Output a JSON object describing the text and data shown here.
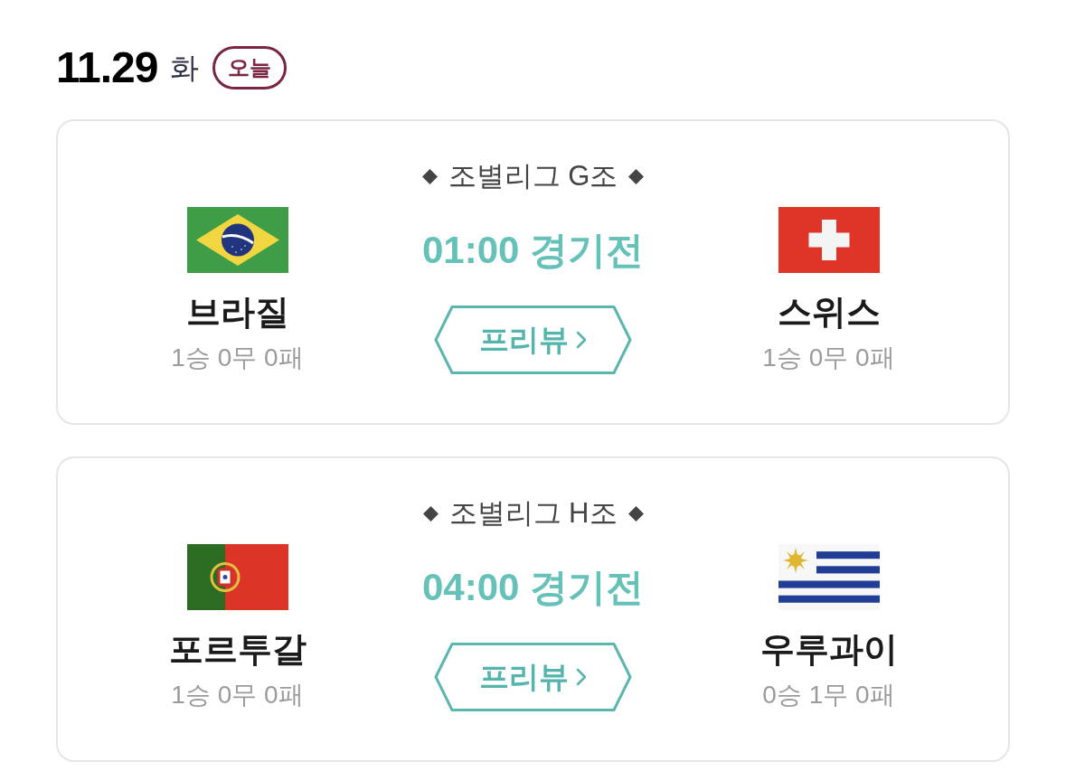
{
  "date": {
    "day": "11.29",
    "weekday": "화",
    "badge": "오늘"
  },
  "matches": [
    {
      "group": "조별리그 G조",
      "time": "01:00 경기전",
      "button": "프리뷰",
      "home": {
        "name": "브라질",
        "record": "1승 0무 0패"
      },
      "away": {
        "name": "스위스",
        "record": "1승 0무 0패"
      }
    },
    {
      "group": "조별리그 H조",
      "time": "04:00 경기전",
      "button": "프리뷰",
      "home": {
        "name": "포르투갈",
        "record": "1승 0무 0패"
      },
      "away": {
        "name": "우루과이",
        "record": "0승 1무 0패"
      }
    }
  ]
}
